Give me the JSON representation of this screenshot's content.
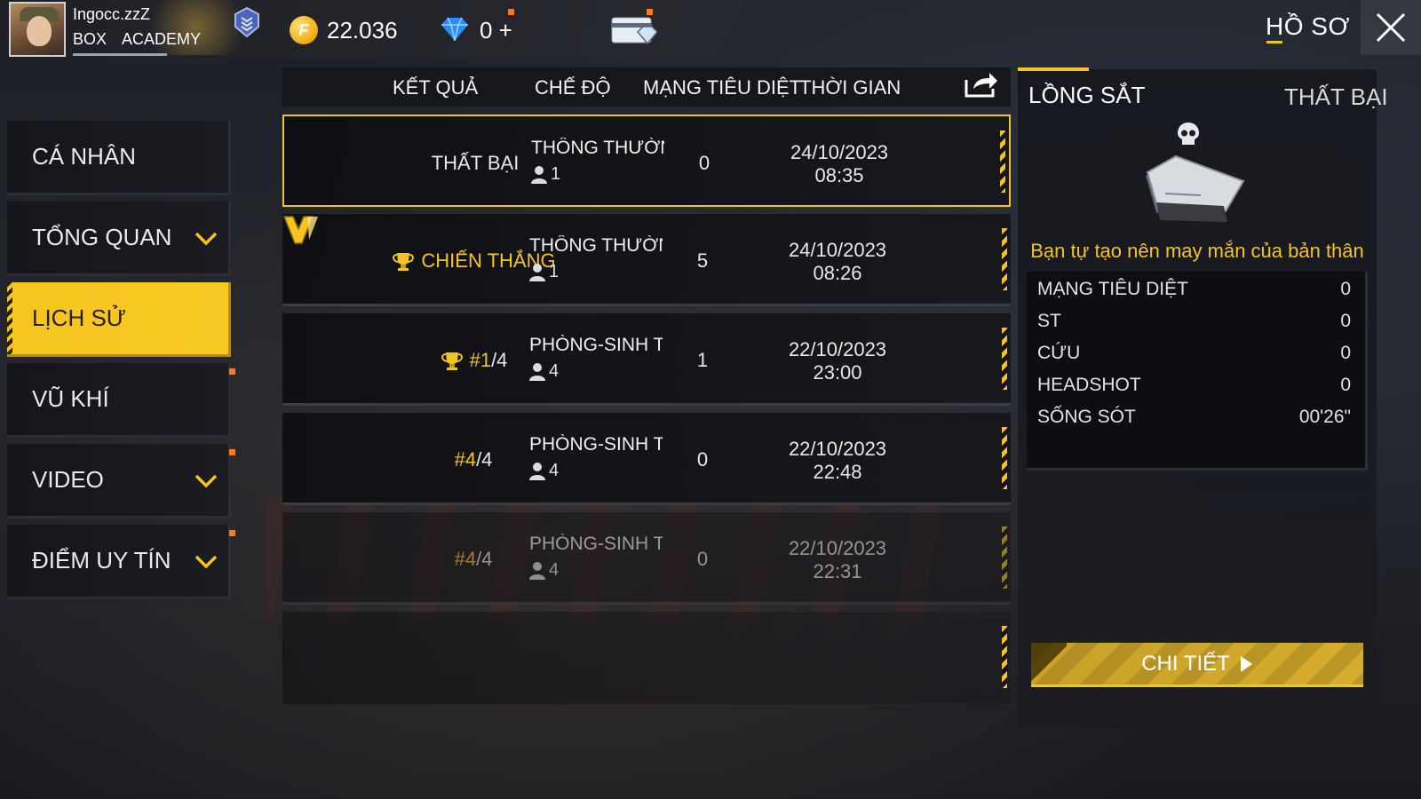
{
  "header": {
    "player_name": "Ingocc.zzZ",
    "guild_tag": "BOX",
    "guild_name": "ACADEMY",
    "coins": "22.036",
    "diamonds": "0 +",
    "page_title": "HỒ SƠ"
  },
  "sidebar": {
    "items": [
      {
        "label": "CÁ NHÂN",
        "has_chevron": false,
        "active": false
      },
      {
        "label": "TỔNG QUAN",
        "has_chevron": true,
        "active": false
      },
      {
        "label": "LỊCH SỬ",
        "has_chevron": false,
        "active": true
      },
      {
        "label": "VŨ KHÍ",
        "has_chevron": false,
        "active": false
      },
      {
        "label": "VIDEO",
        "has_chevron": true,
        "active": false
      },
      {
        "label": "ĐIỂM UY TÍN",
        "has_chevron": true,
        "active": false
      }
    ]
  },
  "table": {
    "headers": {
      "result": "KẾT QUẢ",
      "mode": "CHẾ ĐỘ",
      "kills": "MẠNG TIÊU DIỆT",
      "time": "THỜI GIAN"
    },
    "rows": [
      {
        "result": "THẤT BẠI",
        "mode": "THÔNG THƯỜNG-I",
        "players": "1",
        "kills": "0",
        "date": "24/10/2023",
        "time": "08:35"
      },
      {
        "result": "CHIẾN THẮNG",
        "mode": "THÔNG THƯỜNG-I",
        "players": "1",
        "kills": "5",
        "date": "24/10/2023",
        "time": "08:26"
      },
      {
        "result_rank": "#1",
        "result_total": "/4",
        "mode": "PHÒNG-SINH TỒN",
        "players": "4",
        "kills": "1",
        "date": "22/10/2023",
        "time": "23:00"
      },
      {
        "result_rank": "#4",
        "result_total": "/4",
        "mode": "PHÒNG-SINH TỒN",
        "players": "4",
        "kills": "0",
        "date": "22/10/2023",
        "time": "22:48"
      },
      {
        "result_rank": "#4",
        "result_total": "/4",
        "mode": "PHÒNG-SINH TỒN",
        "players": "4",
        "kills": "0",
        "date": "22/10/2023",
        "time": "22:31"
      }
    ]
  },
  "detail": {
    "map_name": "LỒNG SẮT",
    "result": "THẤT BẠI",
    "quote": "Bạn tự tạo nên may mắn của bản thân",
    "stats": [
      {
        "label": "MẠNG TIÊU DIỆT",
        "value": "0"
      },
      {
        "label": "ST",
        "value": "0"
      },
      {
        "label": "CỨU",
        "value": "0"
      },
      {
        "label": "HEADSHOT",
        "value": "0"
      },
      {
        "label": "SỐNG SÓT",
        "value": "00'26\""
      }
    ],
    "button_label": "CHI TIẾT"
  },
  "colors": {
    "accent": "#f7c324",
    "notification": "#ff7a1a"
  }
}
